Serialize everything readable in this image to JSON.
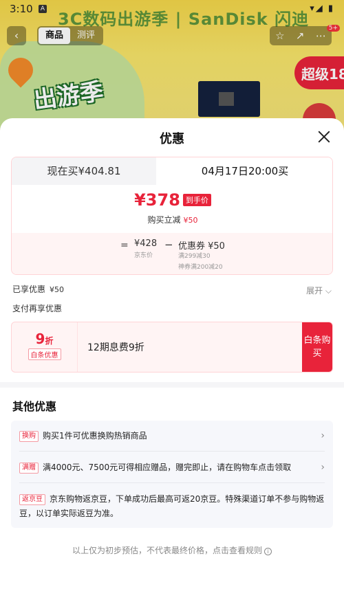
{
  "status_bar": {
    "time": "3:10",
    "icon_a": "A",
    "icons": "▾◢ ▮"
  },
  "background": {
    "banner_text": "3C数码出游季 | SanDisk 闪迪",
    "logo_text": "出游季",
    "badge_text": "超级18",
    "nav": {
      "back": "‹",
      "tabs": [
        "商品",
        "测评"
      ],
      "active_tab": 0,
      "right_icons": [
        "star-icon",
        "share-icon",
        "more-icon"
      ],
      "badge": "5+"
    }
  },
  "sheet": {
    "title": "优惠",
    "price_card": {
      "tab_now": "现在买¥404.81",
      "tab_later": "04月17日20:00买",
      "price": "¥378",
      "price_tag": "到手价",
      "sub_label": "购买立减",
      "sub_amount": "¥50",
      "breakdown": {
        "eq": "=",
        "base_price": "¥428",
        "base_label": "京东价",
        "minus": "−",
        "coupon": "优惠券 ¥50",
        "coupon_line1": "满299减30",
        "coupon_line2": "神券满200减20"
      }
    },
    "enjoyed_label": "已享优惠",
    "enjoyed_amount": "¥50",
    "expand_label": "展开 ⌵",
    "pay_more_label": "支付再享优惠",
    "baitiao": {
      "discount": "9",
      "discount_unit": "折",
      "label": "白条优惠",
      "text": "12期息费9折",
      "button": "白条购买"
    },
    "other_title": "其他优惠",
    "offers": [
      {
        "tag": "换购",
        "text": "购买1件可优惠换购热销商品",
        "chevron": "›"
      },
      {
        "tag": "满赠",
        "text": "满4000元、7500元可得相应赠品，赠完即止，请在购物车点击领取",
        "chevron": "›"
      },
      {
        "tag": "返京豆",
        "text": "京东购物返京豆，下单成功后最高可返20京豆。特殊渠道订单不参与购物返豆，以订单实际返豆为准。"
      }
    ],
    "footer_note": "以上仅为初步预估，不代表最终价格，点击查看规则",
    "info_icon": "i"
  },
  "colors": {
    "accent": "#e8233a",
    "card_bg": "#fff4f4",
    "other_bg": "#f6f7fb"
  }
}
